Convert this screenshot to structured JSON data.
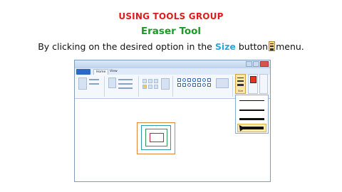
{
  "heading": "USING TOOLS GROUP",
  "subheading": "Eraser Tool",
  "instruction": {
    "before": "By clicking on the desired option in the ",
    "highlight": "Size",
    "after_button": " button",
    "after": "menu."
  },
  "colors": {
    "heading": "#e01b1b",
    "subheading": "#1e9a2a",
    "highlight": "#2aa6d8",
    "selected_option": "#fde9a8",
    "color1": "#e8311f"
  },
  "app": {
    "tabs": [
      "Home",
      "View"
    ],
    "ribbon_labels": [
      "Size",
      "Color 1",
      "Color 2"
    ],
    "size_options": [
      1,
      2,
      3,
      4
    ],
    "selected_size_index": 3
  }
}
